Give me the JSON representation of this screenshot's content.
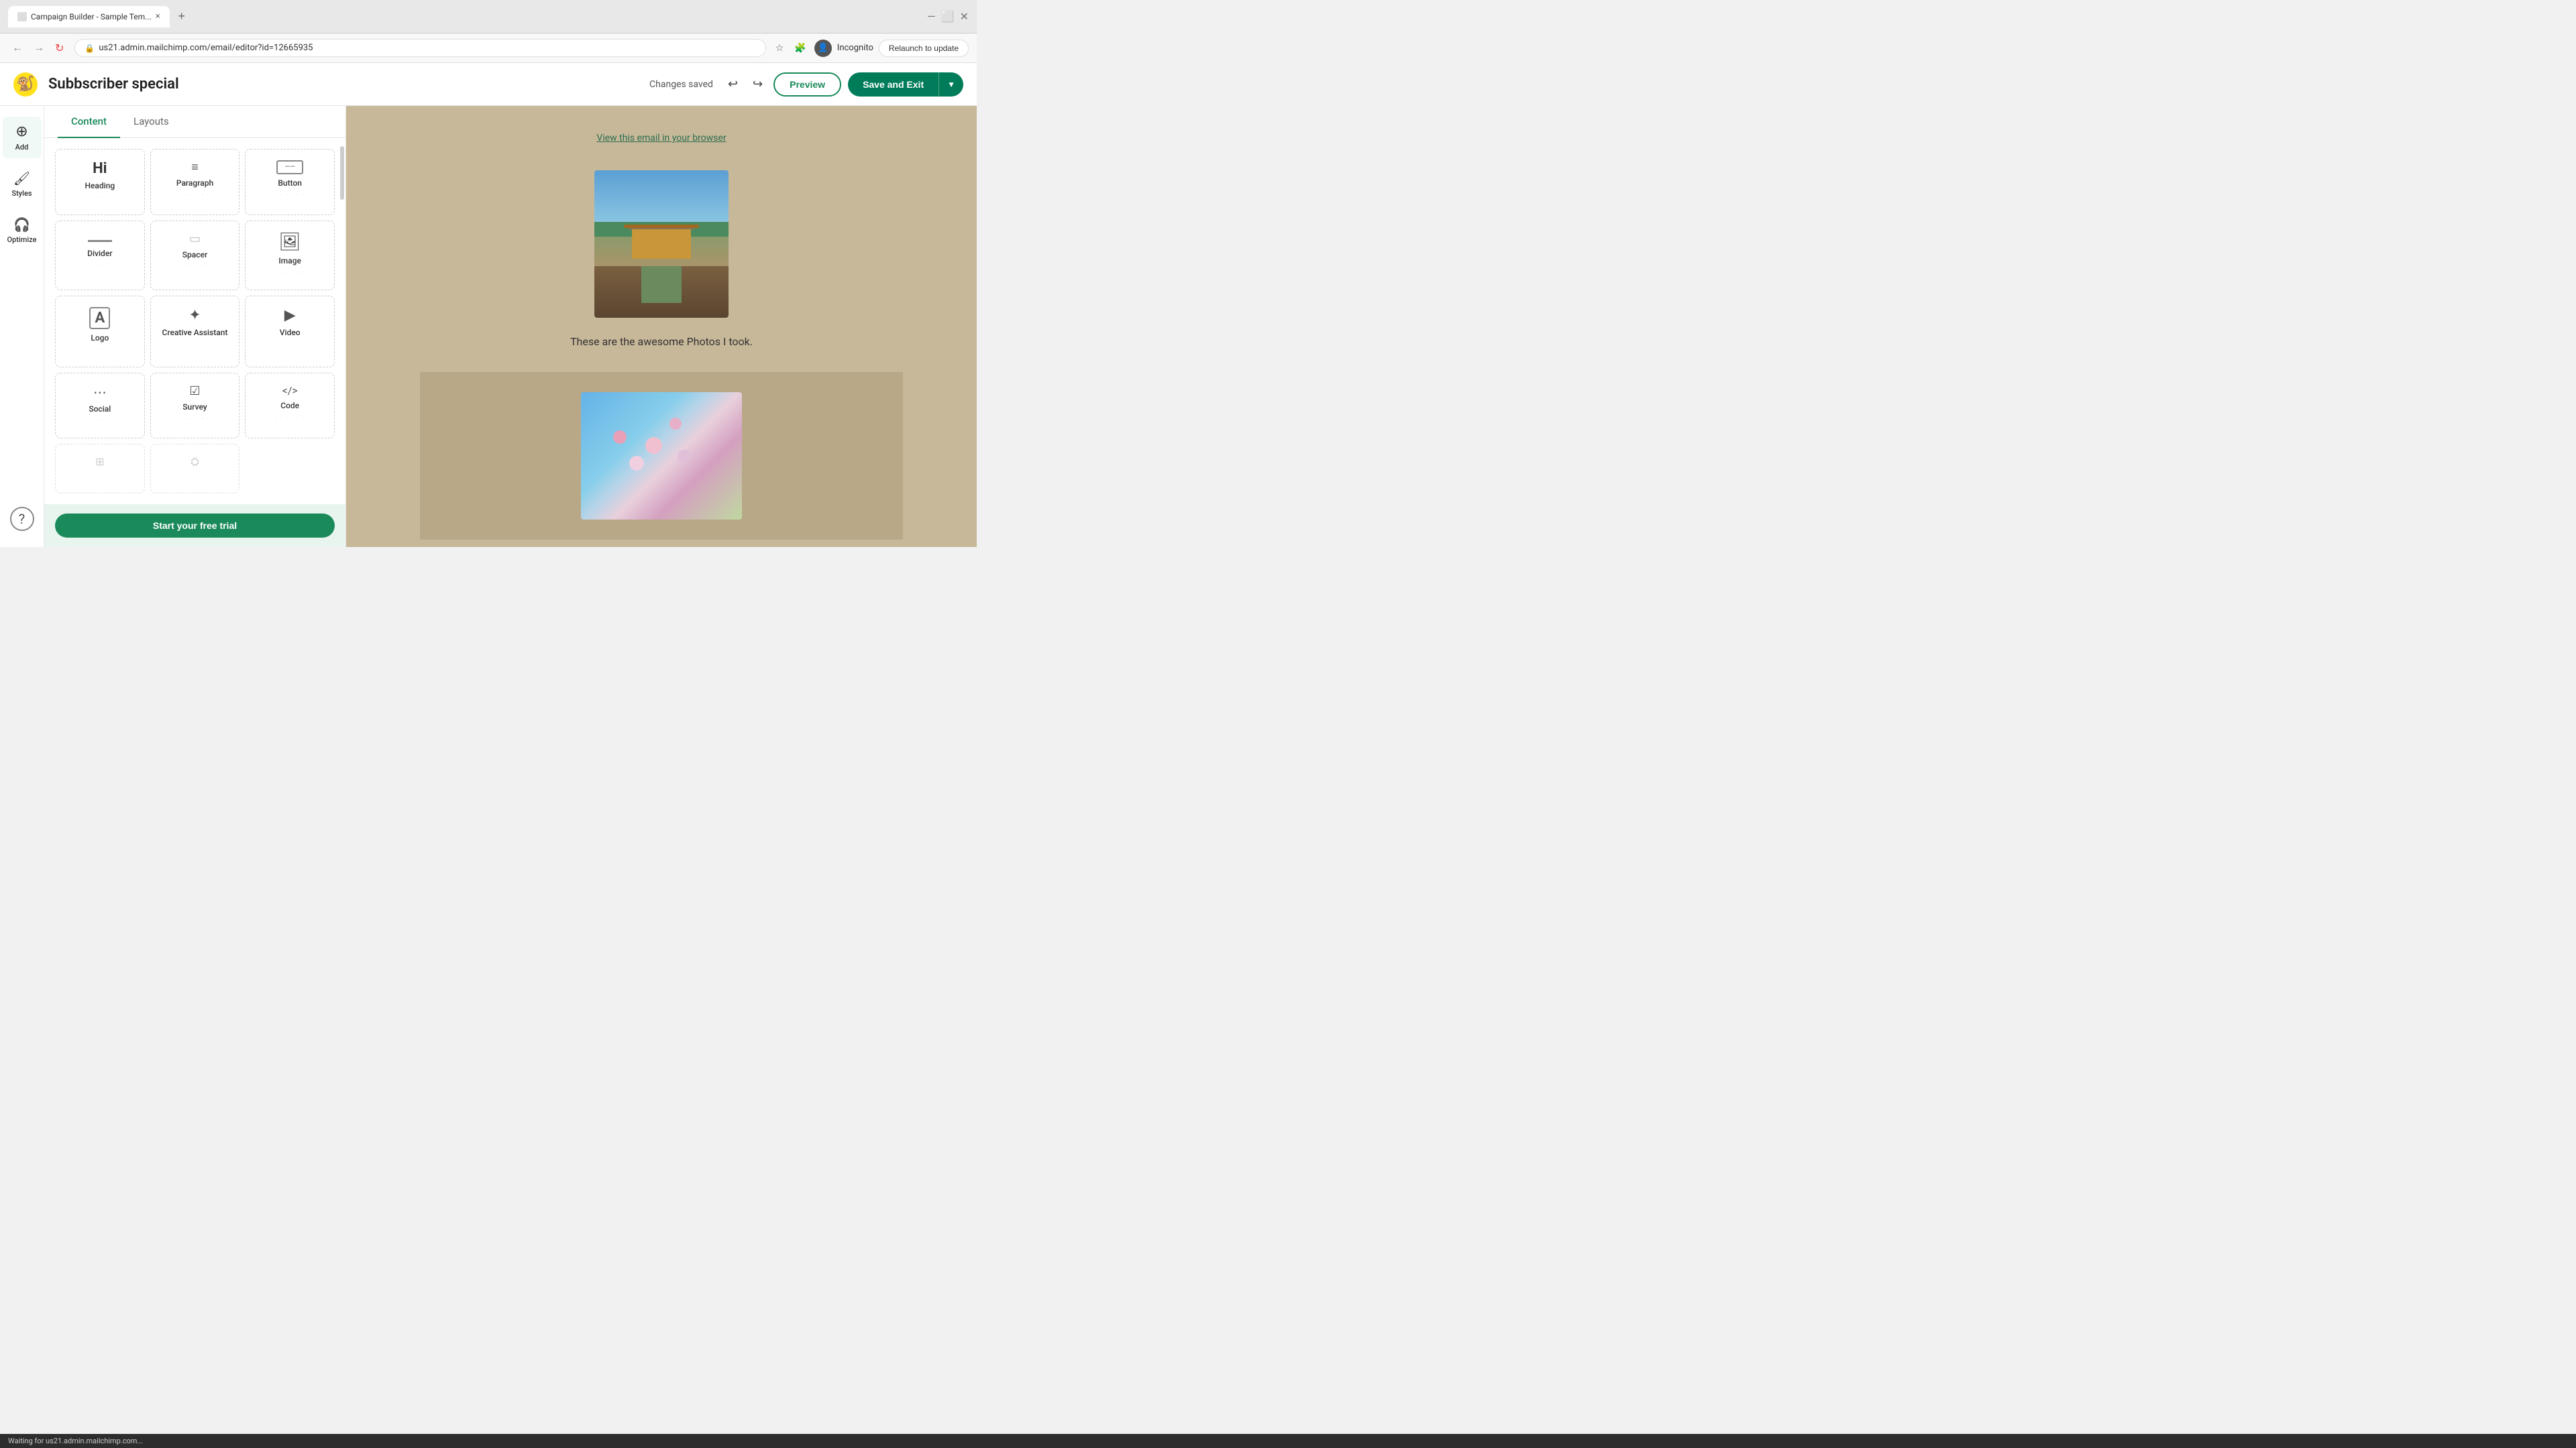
{
  "browser": {
    "tab_title": "Campaign Builder - Sample Tem...",
    "tab_close": "×",
    "new_tab": "+",
    "url": "us21.admin.mailchimp.com/email/editor?id=12665935",
    "nav_back": "←",
    "nav_forward": "→",
    "nav_reload": "↻",
    "incognito_label": "Incognito",
    "relaunch_label": "Relaunch to update"
  },
  "toolbar": {
    "campaign_name": "Subbscriber special",
    "status_text": "Changes saved",
    "undo_icon": "↩",
    "redo_icon": "↪",
    "preview_label": "Preview",
    "save_exit_label": "Save and Exit",
    "dropdown_icon": "▼"
  },
  "sidebar": {
    "items": [
      {
        "id": "add",
        "label": "Add",
        "icon": "⊕"
      },
      {
        "id": "styles",
        "label": "Styles",
        "icon": "🎨"
      },
      {
        "id": "optimize",
        "label": "Optimize",
        "icon": "🎧"
      }
    ],
    "help_label": "?"
  },
  "content_panel": {
    "tabs": [
      {
        "id": "content",
        "label": "Content"
      },
      {
        "id": "layouts",
        "label": "Layouts"
      }
    ],
    "active_tab": "content",
    "items": [
      {
        "id": "heading",
        "label": "Heading",
        "icon": "Hi"
      },
      {
        "id": "paragraph",
        "label": "Paragraph",
        "icon": "≡"
      },
      {
        "id": "button",
        "label": "Button",
        "icon": "—"
      },
      {
        "id": "divider",
        "label": "Divider",
        "icon": "—"
      },
      {
        "id": "spacer",
        "label": "Spacer",
        "icon": "⬜"
      },
      {
        "id": "image",
        "label": "Image",
        "icon": "🖼"
      },
      {
        "id": "logo",
        "label": "Logo",
        "icon": "A"
      },
      {
        "id": "creative-assistant",
        "label": "Creative Assistant",
        "icon": "✦"
      },
      {
        "id": "video",
        "label": "Video",
        "icon": "▶"
      },
      {
        "id": "social",
        "label": "Social",
        "icon": "⋯"
      },
      {
        "id": "survey",
        "label": "Survey",
        "icon": "☑"
      },
      {
        "id": "code",
        "label": "Code",
        "icon": "< />"
      }
    ],
    "free_trial_label": "Start your free trial"
  },
  "email": {
    "view_link_text": "View this email in your browser",
    "photo_caption": "These are the awesome Photos I took."
  },
  "status_bar": {
    "text": "Waiting for us21.admin.mailchimp.com..."
  }
}
